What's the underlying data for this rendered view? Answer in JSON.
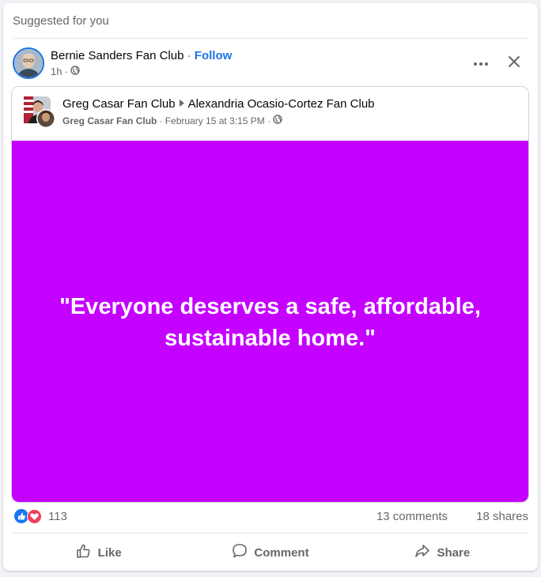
{
  "feed": {
    "suggested_label": "Suggested for you"
  },
  "post": {
    "author": "Bernie Sanders Fan Club",
    "separator": "·",
    "follow_label": "Follow",
    "time": "1h",
    "meta_separator": "·"
  },
  "shared": {
    "group_from": "Greg Casar Fan Club",
    "group_to": "Alexandria Ocasio-Cortez Fan Club",
    "sub_group": "Greg Casar Fan Club",
    "sub_date": "· February 15 at 3:15 PM ·",
    "quote": "\"Everyone deserves a safe, affordable, sustainable home.\"",
    "background_color": "#c400ff"
  },
  "stats": {
    "reaction_count": "113",
    "comments": "13 comments",
    "shares": "18 shares"
  },
  "actions": {
    "like": "Like",
    "comment": "Comment",
    "share": "Share"
  },
  "icons": {
    "globe": "globe-icon",
    "more": "more-icon",
    "close": "close-icon",
    "like": "thumbs-up-icon",
    "comment": "comment-icon",
    "share": "share-icon"
  },
  "colors": {
    "accent": "#1b74e4",
    "like_blue": "#1877f2",
    "love_red": "#f33e58"
  }
}
